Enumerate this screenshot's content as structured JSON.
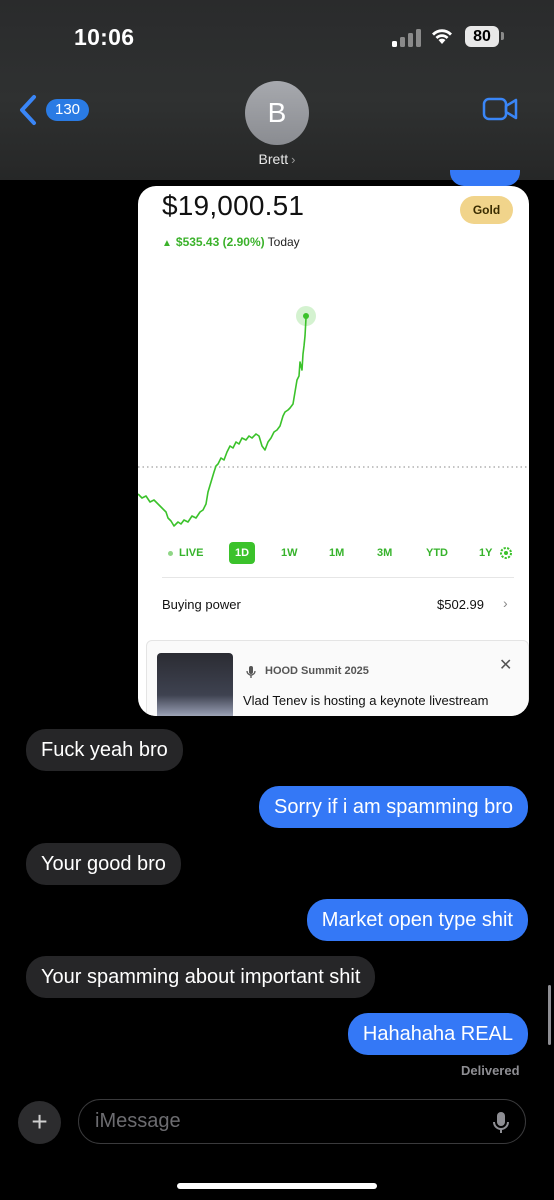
{
  "status_bar": {
    "time": "10:06",
    "battery": "80"
  },
  "header": {
    "back_count": "130",
    "avatar_initial": "B",
    "contact_name": "Brett"
  },
  "robinhood": {
    "balance": "$19,000.51",
    "badge": "Gold",
    "change": "$535.43 (2.90%)",
    "change_period": "Today",
    "accent": "#3bc22b",
    "ranges": [
      "LIVE",
      "1D",
      "1W",
      "1M",
      "3M",
      "YTD",
      "1Y"
    ],
    "selected_range": "1D",
    "buying_power_label": "Buying power",
    "buying_power_value": "$502.99",
    "news_kicker": "HOOD Summit 2025",
    "news_title": "Vlad Tenev is hosting a keynote livestream"
  },
  "messages": [
    {
      "side": "in",
      "text": "Fuck yeah bro"
    },
    {
      "side": "out",
      "text": "Sorry if i am spamming bro"
    },
    {
      "side": "in",
      "text": "Your good bro"
    },
    {
      "side": "out",
      "text": "Market open type shit"
    },
    {
      "side": "in",
      "text": "Your spamming about important shit"
    },
    {
      "side": "out",
      "text": "Hahahaha REAL"
    }
  ],
  "delivered": "Delivered",
  "composer": {
    "placeholder": "iMessage"
  },
  "colors": {
    "outgoing_bubble": "#3478f6",
    "incoming_bubble": "#262628",
    "accent_green": "#3bc22b"
  }
}
